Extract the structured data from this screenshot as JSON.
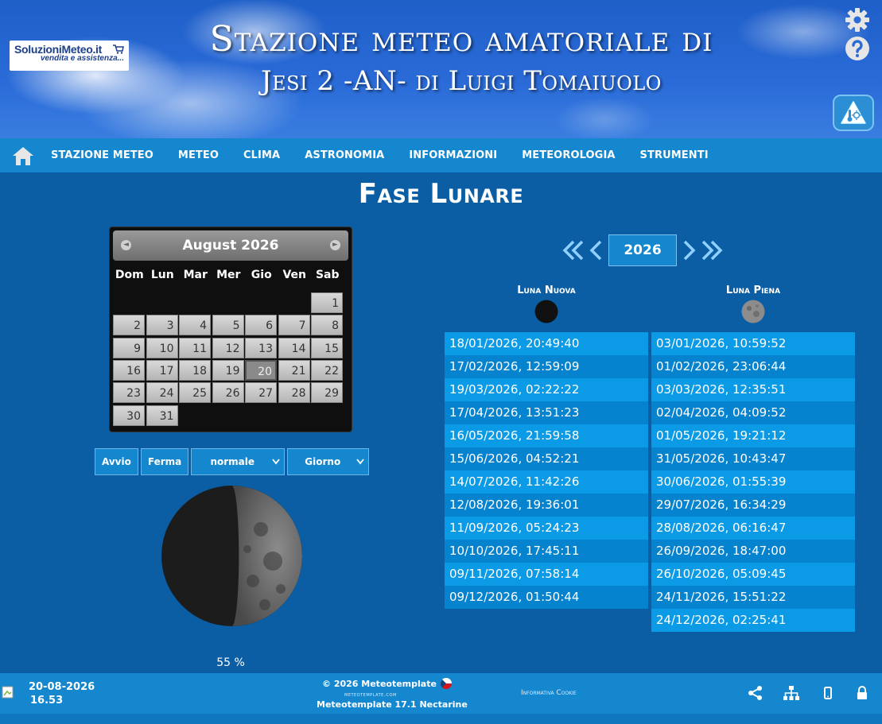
{
  "header": {
    "logo_main": "SoluzioniMeteo.it",
    "logo_sub": "vendita e assistenza...",
    "title_line1": "Stazione meteo amatoriale di",
    "title_line2": "Jesi 2 -AN- di Luigi Tomaiuolo"
  },
  "nav": {
    "items": [
      "STAZIONE METEO",
      "METEO",
      "CLIMA",
      "ASTRONOMIA",
      "INFORMAZIONI",
      "METEOROLOGIA",
      "STRUMENTI"
    ]
  },
  "page_title": "Fase Lunare",
  "calendar": {
    "title": "August 2026",
    "prev_glyph": "◄",
    "next_glyph": "►",
    "days_of_week": [
      "Dom",
      "Lun",
      "Mar",
      "Mer",
      "Gio",
      "Ven",
      "Sab"
    ],
    "first_weekday_index": 6,
    "days_in_month": 31,
    "selected_day": 20
  },
  "controls": {
    "start_label": "Avvio",
    "stop_label": "Ferma",
    "speed_value": "normale",
    "step_value": "Giorno"
  },
  "moon": {
    "illumination_label": "55 %",
    "illumination_fraction": 0.55
  },
  "year_nav": {
    "year": "2026"
  },
  "phases": {
    "new_moon_title": "Luna Nuova",
    "full_moon_title": "Luna Piena",
    "new_moon_dates": [
      "18/01/2026, 20:49:40",
      "17/02/2026, 12:59:09",
      "19/03/2026, 02:22:22",
      "17/04/2026, 13:51:23",
      "16/05/2026, 21:59:58",
      "15/06/2026, 04:52:21",
      "14/07/2026, 11:42:26",
      "12/08/2026, 19:36:01",
      "11/09/2026, 05:24:23",
      "10/10/2026, 17:45:11",
      "09/11/2026, 07:58:14",
      "09/12/2026, 01:50:44"
    ],
    "full_moon_dates": [
      "03/01/2026, 10:59:52",
      "01/02/2026, 23:06:44",
      "03/03/2026, 12:35:51",
      "02/04/2026, 04:09:52",
      "01/05/2026, 19:21:12",
      "31/05/2026, 10:43:47",
      "30/06/2026, 01:55:39",
      "29/07/2026, 16:34:29",
      "28/08/2026, 06:16:47",
      "26/09/2026, 18:47:00",
      "26/10/2026, 05:09:45",
      "24/11/2026, 15:51:22",
      "24/12/2026, 02:25:41"
    ]
  },
  "footer": {
    "date": "20-08-2026",
    "time": "16.53",
    "copyright": "© 2026  Meteotemplate",
    "site": "meteotemplate.com",
    "version": "Meteotemplate 17.1 Nectarine",
    "cookie": "Informativa Cookie"
  },
  "icons": {
    "header": [
      "gear-icon",
      "help-icon",
      "weather-app-icon"
    ],
    "nav": "home-icon",
    "footer": [
      "share-icon",
      "sitemap-icon",
      "mobile-icon",
      "lock-icon"
    ]
  },
  "colors": {
    "background": "#0b5ea4",
    "nav": "#1487cf",
    "row_odd": "#0b9be6",
    "row_even": "#0683cf"
  }
}
